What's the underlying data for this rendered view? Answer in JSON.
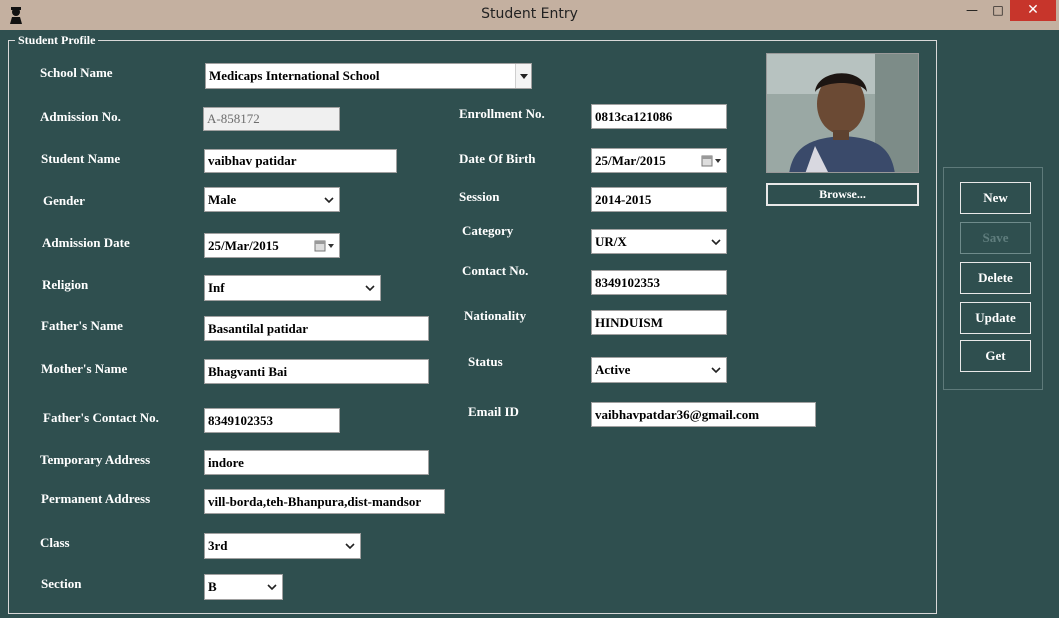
{
  "window": {
    "title": "Student Entry",
    "minimize": "—",
    "maximize": "□",
    "close": "✕"
  },
  "group": {
    "legend": "Student Profile"
  },
  "labels": {
    "school_name": "School Name",
    "admission_no": "Admission No.",
    "student_name": "Student Name",
    "gender": "Gender",
    "admission_date": "Admission Date",
    "religion": "Religion",
    "fathers_name": "Father's Name",
    "mothers_name": "Mother's Name",
    "fathers_contact": "Father's Contact No.",
    "temporary_address": "Temporary Address",
    "permanent_address": "Permanent Address",
    "class": "Class",
    "section": "Section",
    "enrollment_no": "Enrollment No.",
    "date_of_birth": "Date Of Birth",
    "session": "Session",
    "category": "Category",
    "contact_no": "Contact No.",
    "nationality": "Nationality",
    "status": "Status",
    "email_id": "Email ID"
  },
  "values": {
    "school_name": "Medicaps International School",
    "admission_no": "A-858172",
    "student_name": "vaibhav patidar",
    "gender": "Male",
    "admission_date": "25/Mar/2015",
    "religion": "Inf",
    "fathers_name": "Basantilal patidar",
    "mothers_name": "Bhagvanti Bai",
    "fathers_contact": "8349102353",
    "temporary_address": "indore",
    "permanent_address": "vill-borda,teh-Bhanpura,dist-mandsor",
    "class": "3rd",
    "section": "B",
    "enrollment_no": "0813ca121086",
    "date_of_birth": "25/Mar/2015",
    "session": "2014-2015",
    "category": "UR/X",
    "contact_no": "8349102353",
    "nationality": "HINDUISM",
    "status": "Active",
    "email_id": "vaibhavpatdar36@gmail.com"
  },
  "photo": {
    "browse_label": "Browse..."
  },
  "actions": {
    "new": "New",
    "save": "Save",
    "delete": "Delete",
    "update": "Update",
    "get": "Get"
  },
  "colors": {
    "background": "#2f4f4f",
    "titlebar": "#c4b0a0",
    "close_button": "#c7352b"
  }
}
